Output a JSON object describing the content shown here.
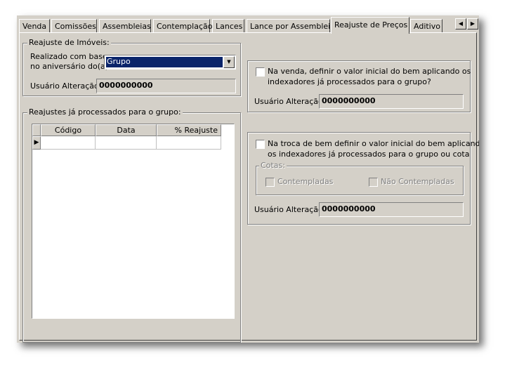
{
  "tabs": [
    {
      "label": "Venda"
    },
    {
      "label": "Comissões"
    },
    {
      "label": "Assembleias"
    },
    {
      "label": "Contemplação"
    },
    {
      "label": "Lances"
    },
    {
      "label": "Lance por Assembleia"
    },
    {
      "label": "Reajuste de Preços"
    },
    {
      "label": "Aditivo"
    }
  ],
  "active_tab": "Reajuste de Preços",
  "imoveis": {
    "title": "Reajuste de Imóveis:",
    "realizado_label_1": "Realizado com base",
    "realizado_label_2": "no aniversário do(a):",
    "combo_value": "Grupo",
    "usuario_label": "Usuário Alteração:",
    "usuario_value": "0000000000"
  },
  "venda": {
    "checkbox_text_1": "Na venda, definir o valor inicial do bem aplicando os",
    "checkbox_text_2": "indexadores já processados para o grupo?",
    "usuario_label": "Usuário Alteração:",
    "usuario_value": "0000000000"
  },
  "processados": {
    "title": "Reajustes já processados para o grupo:",
    "columns": [
      "Código",
      "Data",
      "% Reajuste"
    ]
  },
  "troca": {
    "checkbox_text_1": "Na troca de bem definir o valor inicial do bem aplicando",
    "checkbox_text_2": "os indexadores já processados para o grupo ou cota",
    "cotas_title": "Cotas:",
    "contempladas": "Contempladas",
    "nao_contempladas": "Não Contempladas",
    "usuario_label": "Usuário Alteração:",
    "usuario_value": "0000000000"
  }
}
